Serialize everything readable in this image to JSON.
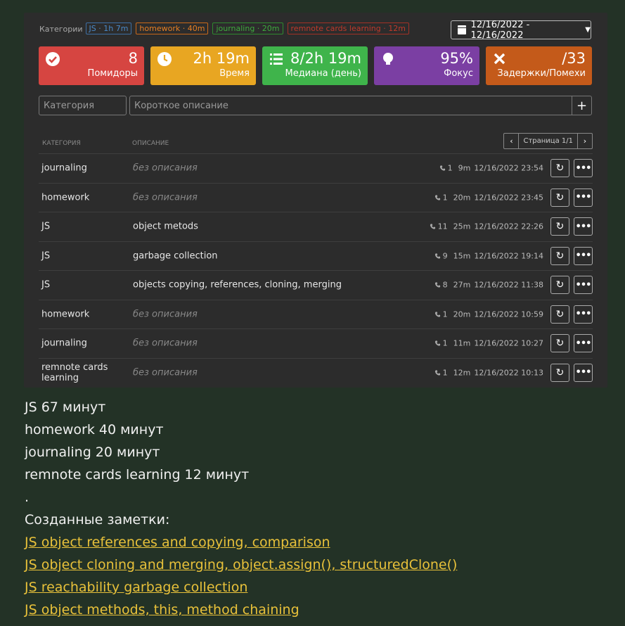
{
  "categories_bar": {
    "label": "Категории",
    "tags": [
      {
        "text": "JS · 1h 7m",
        "cls": "js"
      },
      {
        "text": "homework · 40m",
        "cls": "hw"
      },
      {
        "text": "journaling · 20m",
        "cls": "jr"
      },
      {
        "text": "remnote cards learning · 12m",
        "cls": "rn"
      }
    ]
  },
  "date_range": "12/16/2022 - 12/16/2022",
  "stats": [
    {
      "value": "8",
      "caption": "Помидоры",
      "icon": "check-circle-icon"
    },
    {
      "value": "2h 19m",
      "caption": "Время",
      "icon": "clock-icon"
    },
    {
      "value": "8/2h 19m",
      "caption": "Медиана (день)",
      "icon": "list-icon"
    },
    {
      "value": "95%",
      "caption": "Фокус",
      "icon": "lightbulb-icon"
    },
    {
      "value": "/33",
      "caption": "Задержки/Помехи",
      "icon": "close-icon"
    }
  ],
  "inputs": {
    "category_placeholder": "Категория",
    "description_placeholder": "Короткое описание",
    "add_label": "+"
  },
  "table": {
    "header_category": "КАТЕГОРИЯ",
    "header_description": "ОПИСАНИЕ",
    "pager": "Страница 1/1",
    "rows": [
      {
        "category": "journaling",
        "description": "без описания",
        "empty": true,
        "count": "1",
        "duration": "9m",
        "datetime": "12/16/2022 23:54"
      },
      {
        "category": "homework",
        "description": "без описания",
        "empty": true,
        "count": "1",
        "duration": "20m",
        "datetime": "12/16/2022 23:45"
      },
      {
        "category": "JS",
        "description": "object metods",
        "empty": false,
        "count": "11",
        "duration": "25m",
        "datetime": "12/16/2022 22:26"
      },
      {
        "category": "JS",
        "description": "garbage collection",
        "empty": false,
        "count": "9",
        "duration": "15m",
        "datetime": "12/16/2022 19:14"
      },
      {
        "category": "JS",
        "description": "objects copying, references, cloning, merging",
        "empty": false,
        "count": "8",
        "duration": "27m",
        "datetime": "12/16/2022 11:38"
      },
      {
        "category": "homework",
        "description": "без описания",
        "empty": true,
        "count": "1",
        "duration": "20m",
        "datetime": "12/16/2022 10:59"
      },
      {
        "category": "journaling",
        "description": "без описания",
        "empty": true,
        "count": "1",
        "duration": "11m",
        "datetime": "12/16/2022 10:27"
      },
      {
        "category": "remnote cards learning",
        "description": "без описания",
        "empty": true,
        "count": "1",
        "duration": "12m",
        "datetime": "12/16/2022 10:13"
      }
    ]
  },
  "summary": {
    "lines": [
      "JS 67 минут",
      "homework 40 минут",
      "journaling 20 минут",
      "remnote cards learning 12 минут",
      "."
    ],
    "notes_title": "Созданные заметки:",
    "notes": [
      "JS object references and copying, comparison",
      "JS object cloning and merging, object.assign(), structuredClone()",
      "JS reachability garbage collection",
      "JS object methods, this, method chaining"
    ]
  },
  "colors": {
    "page_bg": "#233226",
    "panel_bg": "#2c2c2c",
    "link": "#e8c13a",
    "red": "#d64541",
    "yellow": "#e8a622",
    "green": "#3fb44b",
    "purple": "#7b3fa3",
    "orange": "#c45a1a"
  }
}
